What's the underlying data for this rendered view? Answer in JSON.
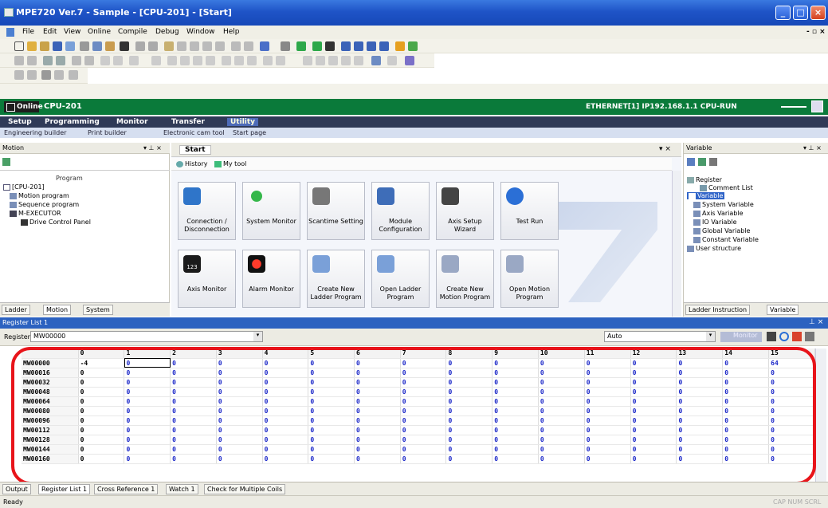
{
  "window": {
    "title": "MPE720 Ver.7 - Sample - [CPU-201] - [Start]"
  },
  "menu": [
    "File",
    "Edit",
    "View",
    "Online",
    "Compile",
    "Debug",
    "Window",
    "Help"
  ],
  "online": {
    "status": "Online",
    "cpu": "CPU-201",
    "connection": "ETHERNET[1] IP192.168.1.1 CPU-RUN"
  },
  "ribbon": {
    "tabs": [
      "Setup",
      "Programming",
      "Monitor",
      "Transfer",
      "Utility"
    ],
    "sub": [
      "Engineering builder",
      "Print builder",
      "Electronic cam tool",
      "Start page"
    ]
  },
  "motion_panel": {
    "title": "Motion",
    "tree": [
      "Program",
      "[CPU-201]",
      "Motion program",
      "Sequence program",
      "M-EXECUTOR",
      "Drive Control Panel"
    ],
    "tabs": [
      "Ladder",
      "Motion",
      "System"
    ]
  },
  "start_panel": {
    "tab": "Start",
    "links": [
      "History",
      "My tool"
    ],
    "tiles_row1": [
      "Connection / Disconnection",
      "System Monitor",
      "Scantime Setting",
      "Module Configuration",
      "Axis Setup Wizard",
      "Test Run"
    ],
    "tiles_row2": [
      "Axis Monitor",
      "Alarm Monitor",
      "Create New Ladder Program",
      "Open Ladder Program",
      "Create New Motion Program",
      "Open Motion Program"
    ],
    "axis_icon_text": "123"
  },
  "variable_panel": {
    "title": "Variable",
    "tree": [
      "Register",
      "Comment List",
      "Variable",
      "System Variable",
      "Axis Variable",
      "IO Variable",
      "Global Variable",
      "Constant Variable",
      "User structure"
    ],
    "tabs": [
      "Ladder Instruction",
      "Variable"
    ]
  },
  "register_list": {
    "title": "Register List 1",
    "register_label": "Register",
    "register_value": "MW00000",
    "mode": "Auto",
    "monitor_label": "Monitor",
    "columns": [
      "0",
      "1",
      "2",
      "3",
      "4",
      "5",
      "6",
      "7",
      "8",
      "9",
      "10",
      "11",
      "12",
      "13",
      "14",
      "15"
    ],
    "rows": [
      {
        "addr": "MW00000",
        "vals": [
          "-4",
          "0",
          "0",
          "0",
          "0",
          "0",
          "0",
          "0",
          "0",
          "0",
          "0",
          "0",
          "0",
          "0",
          "0",
          "64"
        ]
      },
      {
        "addr": "MW00016",
        "vals": [
          "0",
          "0",
          "0",
          "0",
          "0",
          "0",
          "0",
          "0",
          "0",
          "0",
          "0",
          "0",
          "0",
          "0",
          "0",
          "0"
        ]
      },
      {
        "addr": "MW00032",
        "vals": [
          "0",
          "0",
          "0",
          "0",
          "0",
          "0",
          "0",
          "0",
          "0",
          "0",
          "0",
          "0",
          "0",
          "0",
          "0",
          "0"
        ]
      },
      {
        "addr": "MW00048",
        "vals": [
          "0",
          "0",
          "0",
          "0",
          "0",
          "0",
          "0",
          "0",
          "0",
          "0",
          "0",
          "0",
          "0",
          "0",
          "0",
          "0"
        ]
      },
      {
        "addr": "MW00064",
        "vals": [
          "0",
          "0",
          "0",
          "0",
          "0",
          "0",
          "0",
          "0",
          "0",
          "0",
          "0",
          "0",
          "0",
          "0",
          "0",
          "0"
        ]
      },
      {
        "addr": "MW00080",
        "vals": [
          "0",
          "0",
          "0",
          "0",
          "0",
          "0",
          "0",
          "0",
          "0",
          "0",
          "0",
          "0",
          "0",
          "0",
          "0",
          "0"
        ]
      },
      {
        "addr": "MW00096",
        "vals": [
          "0",
          "0",
          "0",
          "0",
          "0",
          "0",
          "0",
          "0",
          "0",
          "0",
          "0",
          "0",
          "0",
          "0",
          "0",
          "0"
        ]
      },
      {
        "addr": "MW00112",
        "vals": [
          "0",
          "0",
          "0",
          "0",
          "0",
          "0",
          "0",
          "0",
          "0",
          "0",
          "0",
          "0",
          "0",
          "0",
          "0",
          "0"
        ]
      },
      {
        "addr": "MW00128",
        "vals": [
          "0",
          "0",
          "0",
          "0",
          "0",
          "0",
          "0",
          "0",
          "0",
          "0",
          "0",
          "0",
          "0",
          "0",
          "0",
          "0"
        ]
      },
      {
        "addr": "MW00144",
        "vals": [
          "0",
          "0",
          "0",
          "0",
          "0",
          "0",
          "0",
          "0",
          "0",
          "0",
          "0",
          "0",
          "0",
          "0",
          "0",
          "0"
        ]
      },
      {
        "addr": "MW00160",
        "vals": [
          "0",
          "0",
          "0",
          "0",
          "0",
          "0",
          "0",
          "0",
          "0",
          "0",
          "0",
          "0",
          "0",
          "0",
          "0",
          "0"
        ]
      }
    ]
  },
  "bottom_tabs": [
    "Output",
    "Register List 1",
    "Cross Reference 1",
    "Watch 1",
    "Check for Multiple Coils"
  ],
  "status": {
    "left": "Ready",
    "right": "CAP NUM SCRL"
  },
  "colors": {
    "online_bar": "#0a7a3a",
    "highlight": "#e8141a",
    "value_blue": "#1a26c8"
  }
}
